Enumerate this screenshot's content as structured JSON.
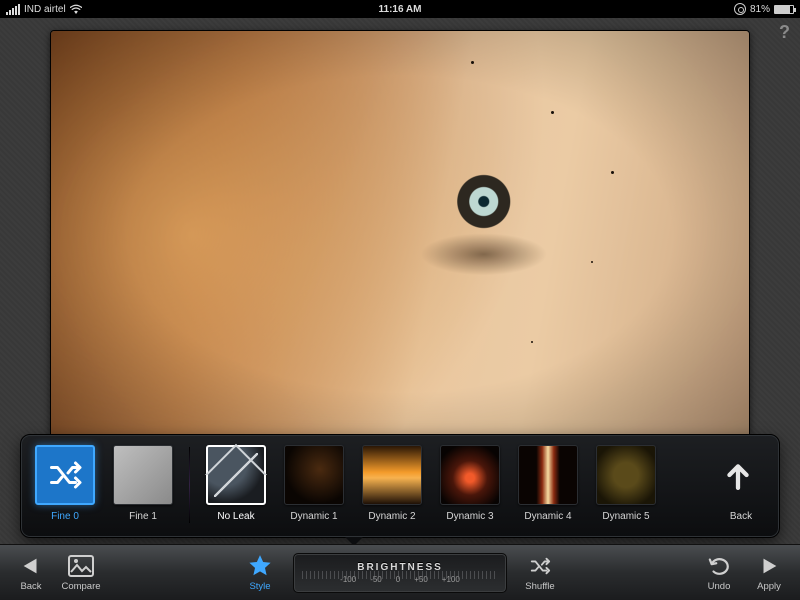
{
  "status": {
    "carrier": "IND airtel",
    "time": "11:16 AM",
    "battery_pct": "81%"
  },
  "help_glyph": "?",
  "styles": {
    "shuffle_label": "Fine 0",
    "items": [
      {
        "label": "Fine 1"
      },
      {
        "label": "No Leak"
      },
      {
        "label": "Dynamic 1"
      },
      {
        "label": "Dynamic 2"
      },
      {
        "label": "Dynamic 3"
      },
      {
        "label": "Dynamic 4"
      },
      {
        "label": "Dynamic 5"
      }
    ],
    "back_label": "Back"
  },
  "slider": {
    "title": "BRIGHTNESS",
    "ticks": [
      "-100",
      "-50",
      "0",
      "+50",
      "+100"
    ]
  },
  "toolbar": {
    "back": "Back",
    "compare": "Compare",
    "style": "Style",
    "shuffle": "Shuffle",
    "undo": "Undo",
    "apply": "Apply"
  }
}
